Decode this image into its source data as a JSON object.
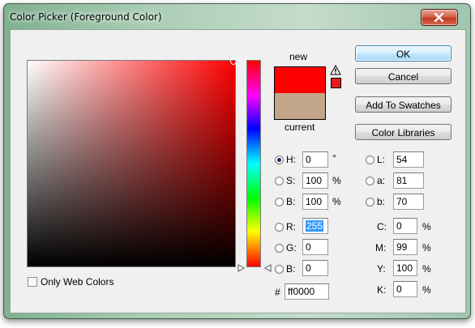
{
  "window": {
    "title": "Color Picker (Foreground Color)"
  },
  "swatch": {
    "new_label": "new",
    "current_label": "current",
    "new_color": "#ff0000",
    "current_color": "#c3a68a"
  },
  "buttons": {
    "ok": "OK",
    "cancel": "Cancel",
    "add_to_swatches": "Add To Swatches",
    "color_libraries": "Color Libraries"
  },
  "hsb": {
    "h": {
      "label": "H:",
      "value": "0",
      "unit": "°"
    },
    "s": {
      "label": "S:",
      "value": "100",
      "unit": "%"
    },
    "b": {
      "label": "B:",
      "value": "100",
      "unit": "%"
    }
  },
  "rgb": {
    "r": {
      "label": "R:",
      "value": "255"
    },
    "g": {
      "label": "G:",
      "value": "0"
    },
    "b": {
      "label": "B:",
      "value": "0"
    }
  },
  "lab": {
    "l": {
      "label": "L:",
      "value": "54"
    },
    "a": {
      "label": "a:",
      "value": "81"
    },
    "b": {
      "label": "b:",
      "value": "70"
    }
  },
  "cmyk": {
    "c": {
      "label": "C:",
      "value": "0",
      "unit": "%"
    },
    "m": {
      "label": "M:",
      "value": "99",
      "unit": "%"
    },
    "y": {
      "label": "Y:",
      "value": "100",
      "unit": "%"
    },
    "k": {
      "label": "K:",
      "value": "0",
      "unit": "%"
    }
  },
  "hex": {
    "label": "#",
    "value": "ff0000"
  },
  "only_web_colors": "Only Web Colors",
  "gamut_warning_color": "#e31c1c",
  "icons": {
    "close": "close-icon",
    "gamut_warning": "warning-triangle-icon",
    "hue_slider": "slider-arrow-icon"
  }
}
